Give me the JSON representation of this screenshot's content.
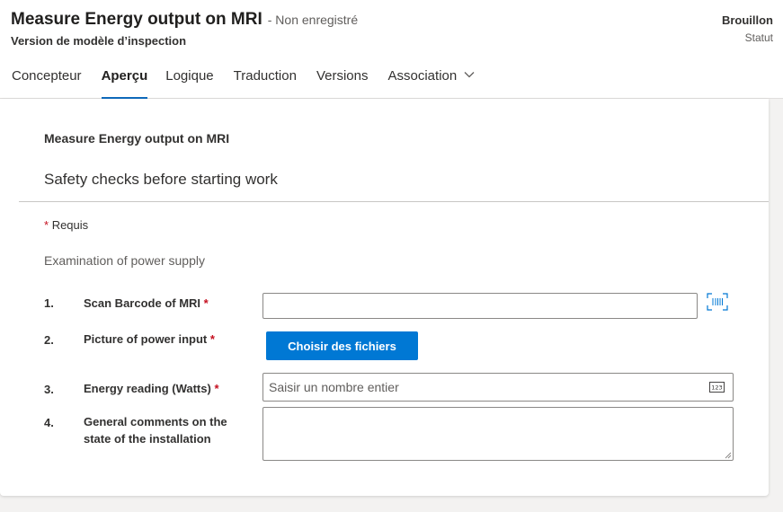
{
  "header": {
    "title": "Measure Energy output on MRI",
    "unsaved": "- Non enregistré",
    "subtitle": "Version de modèle d’inspection",
    "status_value": "Brouillon",
    "status_label": "Statut"
  },
  "tabs": [
    {
      "label": "Concepteur",
      "active": false
    },
    {
      "label": "Aperçu",
      "active": true
    },
    {
      "label": "Logique",
      "active": false
    },
    {
      "label": "Traduction",
      "active": false
    },
    {
      "label": "Versions",
      "active": false
    },
    {
      "label": "Association",
      "active": false
    }
  ],
  "form": {
    "title": "Measure Energy output on MRI",
    "section_title": "Safety checks before starting work",
    "required_star": "*",
    "required_note": "Requis",
    "group_title": "Examination of power supply",
    "questions": [
      {
        "number": "1.",
        "label": "Scan Barcode of MRI",
        "required": true
      },
      {
        "number": "2.",
        "label": "Picture of power input",
        "required": true,
        "button": "Choisir des fichiers"
      },
      {
        "number": "3.",
        "label": "Energy reading (Watts)",
        "required": true,
        "placeholder": "Saisir un nombre entier"
      },
      {
        "number": "4.",
        "label": "General comments on the state of the installation",
        "required": false
      }
    ]
  },
  "colors": {
    "accent": "#0078d4",
    "tab_underline": "#0f6cbd",
    "required": "#c50f1f"
  },
  "icons": [
    "chevron-down-icon",
    "barcode-scan-icon",
    "number-input-icon"
  ]
}
